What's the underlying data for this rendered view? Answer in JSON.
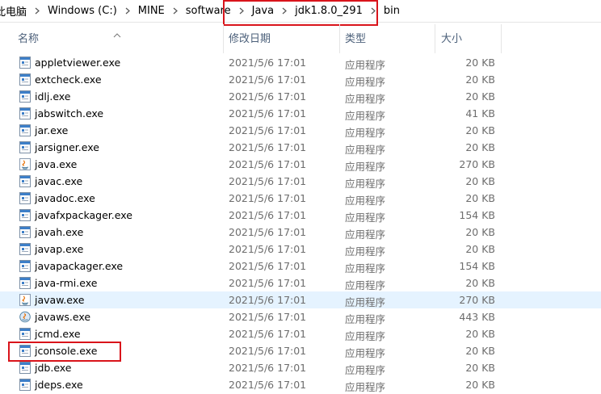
{
  "breadcrumb": [
    "此电脑",
    "Windows (C:)",
    "MINE",
    "software",
    "Java",
    "jdk1.8.0_291",
    "bin"
  ],
  "columns": {
    "name": "名称",
    "date": "修改日期",
    "type": "类型",
    "size": "大小"
  },
  "highlight_color": "#d9141b",
  "selected_row_color": "#e5f3ff",
  "files": [
    {
      "name": "appletviewer.exe",
      "date": "2021/5/6 17:01",
      "type": "应用程序",
      "size": "20 KB",
      "icon": "exe-icon"
    },
    {
      "name": "extcheck.exe",
      "date": "2021/5/6 17:01",
      "type": "应用程序",
      "size": "20 KB",
      "icon": "exe-icon"
    },
    {
      "name": "idlj.exe",
      "date": "2021/5/6 17:01",
      "type": "应用程序",
      "size": "20 KB",
      "icon": "exe-icon"
    },
    {
      "name": "jabswitch.exe",
      "date": "2021/5/6 17:01",
      "type": "应用程序",
      "size": "41 KB",
      "icon": "exe-icon"
    },
    {
      "name": "jar.exe",
      "date": "2021/5/6 17:01",
      "type": "应用程序",
      "size": "20 KB",
      "icon": "exe-icon"
    },
    {
      "name": "jarsigner.exe",
      "date": "2021/5/6 17:01",
      "type": "应用程序",
      "size": "20 KB",
      "icon": "exe-icon"
    },
    {
      "name": "java.exe",
      "date": "2021/5/6 17:01",
      "type": "应用程序",
      "size": "270 KB",
      "icon": "java-icon"
    },
    {
      "name": "javac.exe",
      "date": "2021/5/6 17:01",
      "type": "应用程序",
      "size": "20 KB",
      "icon": "exe-icon"
    },
    {
      "name": "javadoc.exe",
      "date": "2021/5/6 17:01",
      "type": "应用程序",
      "size": "20 KB",
      "icon": "exe-icon"
    },
    {
      "name": "javafxpackager.exe",
      "date": "2021/5/6 17:01",
      "type": "应用程序",
      "size": "154 KB",
      "icon": "exe-icon"
    },
    {
      "name": "javah.exe",
      "date": "2021/5/6 17:01",
      "type": "应用程序",
      "size": "20 KB",
      "icon": "exe-icon"
    },
    {
      "name": "javap.exe",
      "date": "2021/5/6 17:01",
      "type": "应用程序",
      "size": "20 KB",
      "icon": "exe-icon"
    },
    {
      "name": "javapackager.exe",
      "date": "2021/5/6 17:01",
      "type": "应用程序",
      "size": "154 KB",
      "icon": "exe-icon"
    },
    {
      "name": "java-rmi.exe",
      "date": "2021/5/6 17:01",
      "type": "应用程序",
      "size": "20 KB",
      "icon": "exe-icon"
    },
    {
      "name": "javaw.exe",
      "date": "2021/5/6 17:01",
      "type": "应用程序",
      "size": "270 KB",
      "icon": "java-icon",
      "selected": true
    },
    {
      "name": "javaws.exe",
      "date": "2021/5/6 17:01",
      "type": "应用程序",
      "size": "443 KB",
      "icon": "javaws-icon"
    },
    {
      "name": "jcmd.exe",
      "date": "2021/5/6 17:01",
      "type": "应用程序",
      "size": "20 KB",
      "icon": "exe-icon"
    },
    {
      "name": "jconsole.exe",
      "date": "2021/5/6 17:01",
      "type": "应用程序",
      "size": "20 KB",
      "icon": "exe-icon",
      "highlighted": true
    },
    {
      "name": "jdb.exe",
      "date": "2021/5/6 17:01",
      "type": "应用程序",
      "size": "20 KB",
      "icon": "exe-icon"
    },
    {
      "name": "jdeps.exe",
      "date": "2021/5/6 17:01",
      "type": "应用程序",
      "size": "20 KB",
      "icon": "exe-icon"
    }
  ]
}
